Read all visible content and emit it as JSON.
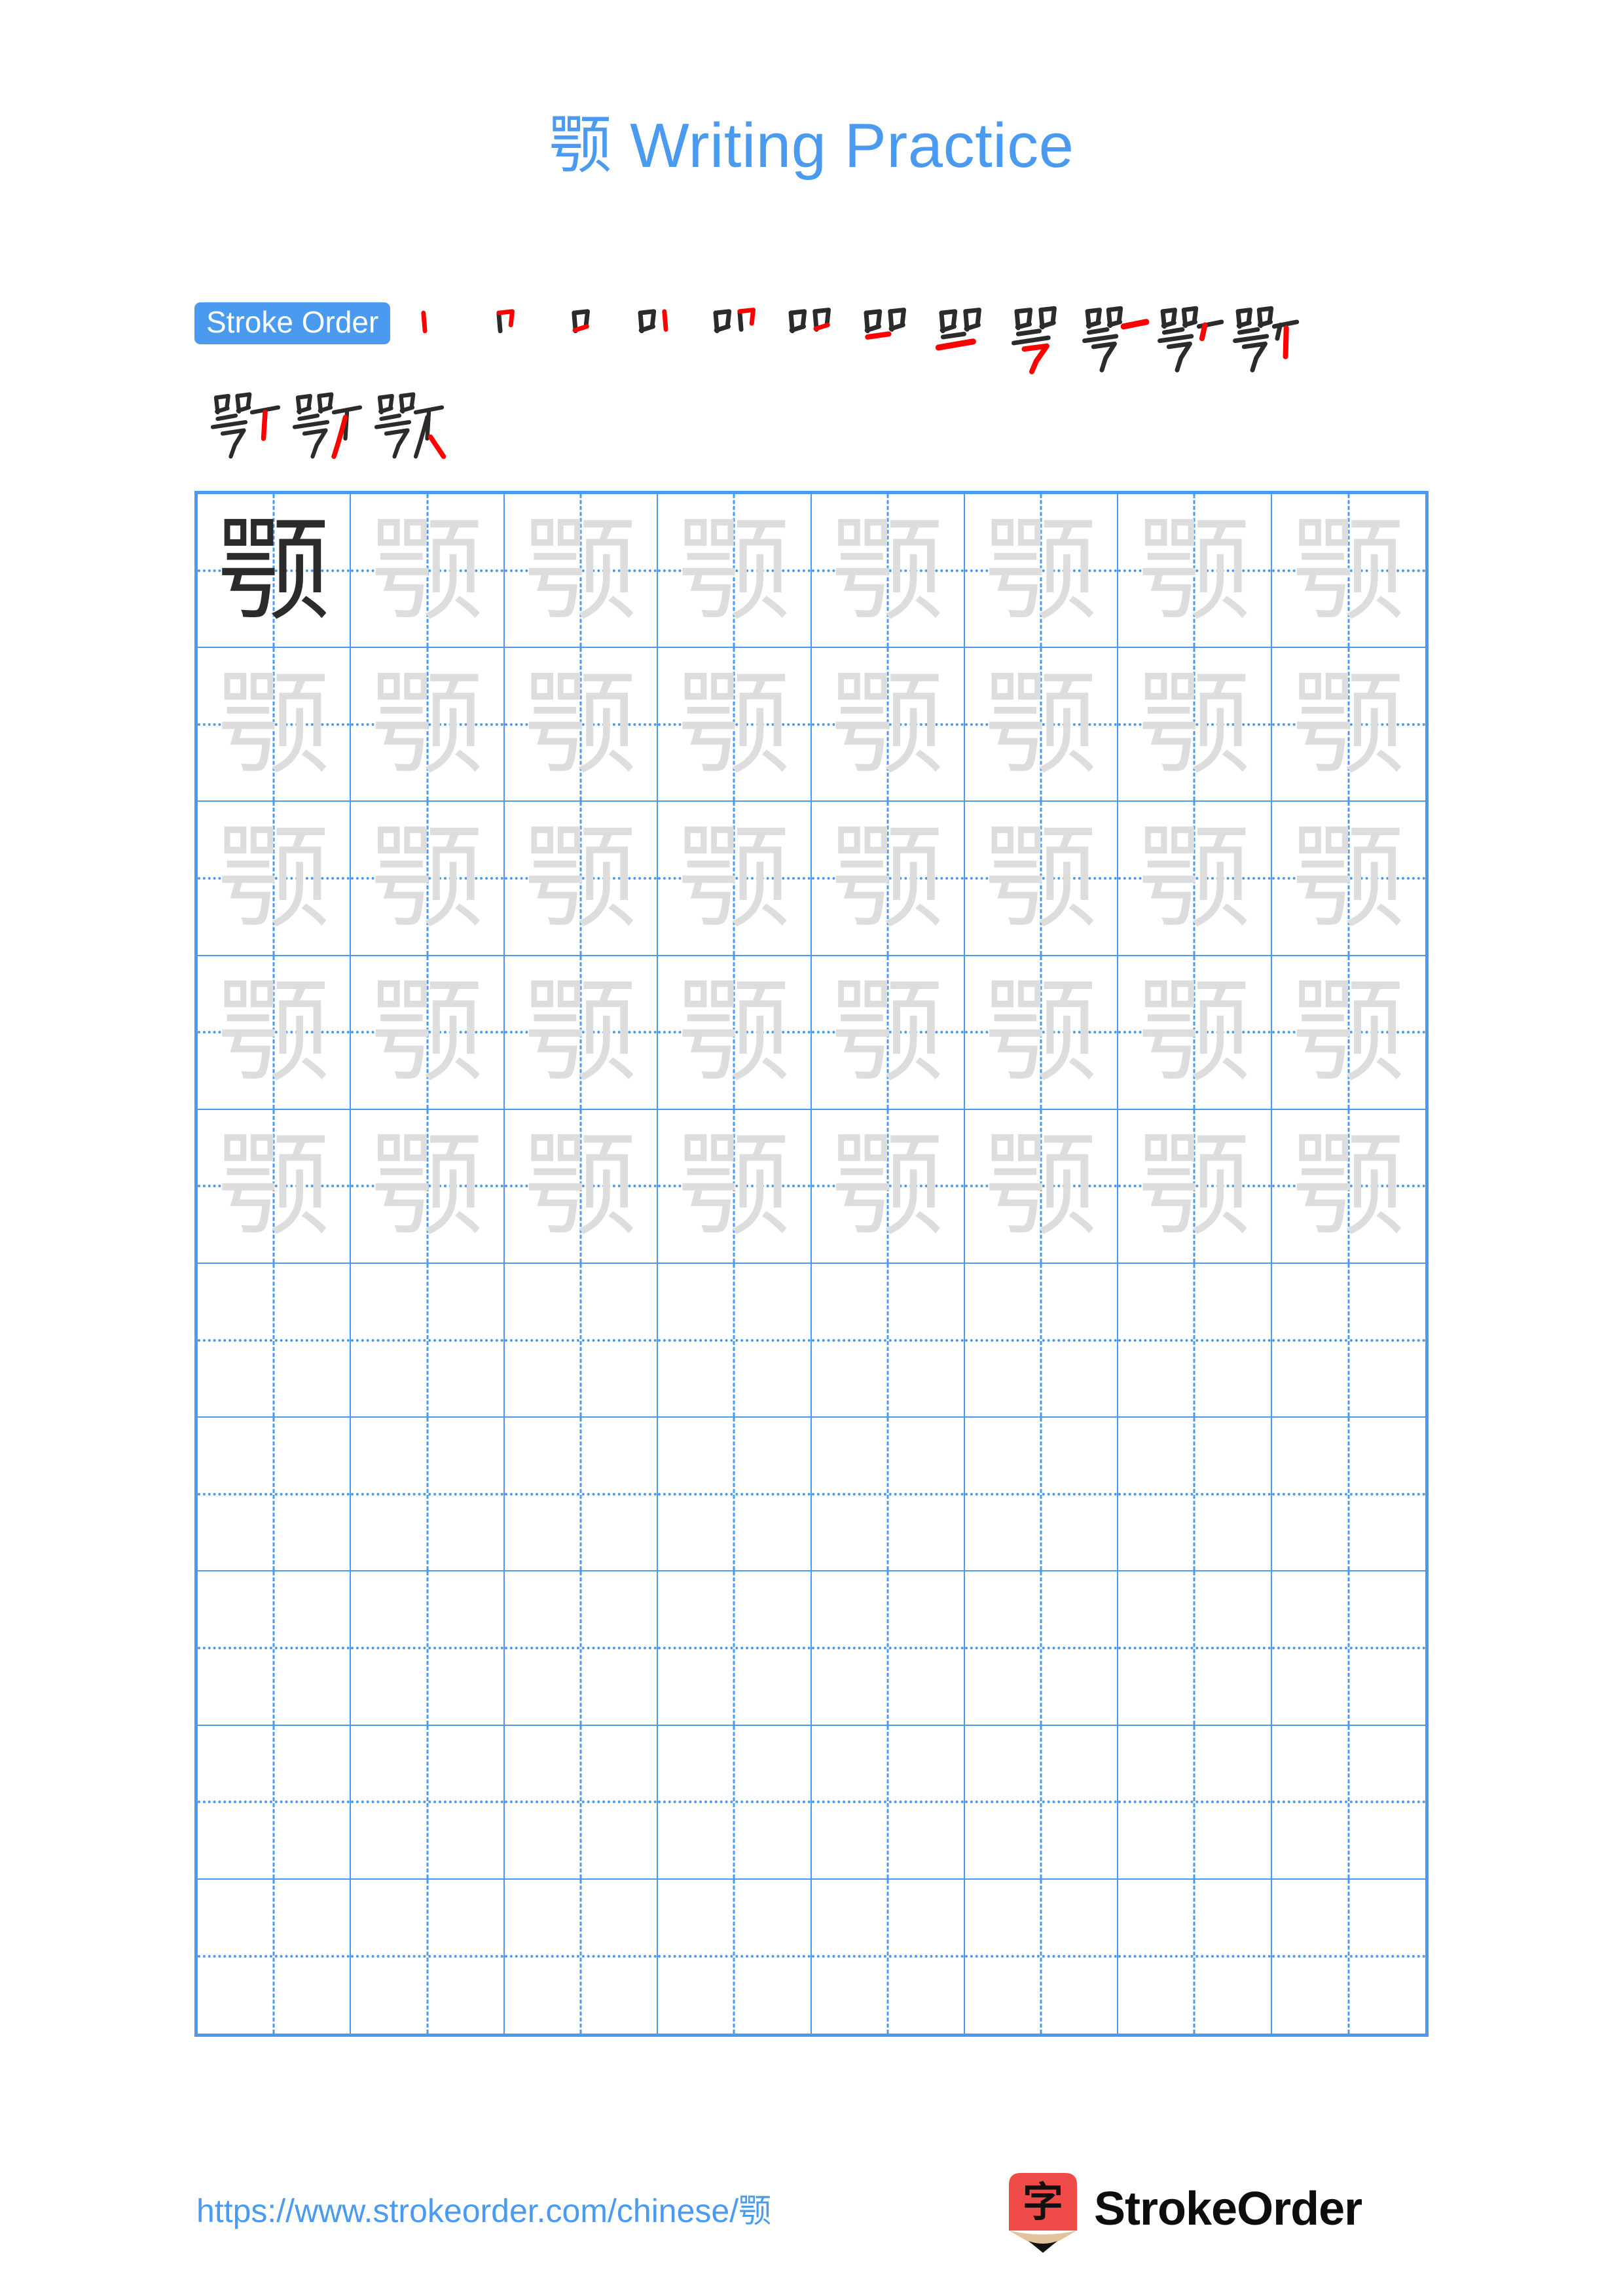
{
  "document": {
    "character": "颚",
    "title": "颚 Writing Practice",
    "accent_color": "#4a9bf0",
    "stroke_new_color": "#ff0000",
    "stroke_done_color": "#2b2b2b",
    "trace_color": "#dddddd",
    "solid_color": "#2b2b2b",
    "background": "#ffffff"
  },
  "stroke_order": {
    "badge_label": "Stroke Order",
    "total_strokes": 15,
    "steps": [
      {
        "index": 1,
        "label": "丨"
      },
      {
        "index": 2,
        "label": "冖"
      },
      {
        "index": 3,
        "label": "口"
      },
      {
        "index": 4,
        "label": "口丨"
      },
      {
        "index": 5,
        "label": "口冖"
      },
      {
        "index": 6,
        "label": "口口"
      },
      {
        "index": 7,
        "label": "吅一"
      },
      {
        "index": 8,
        "label": "吅二"
      },
      {
        "index": 9,
        "label": "咢"
      },
      {
        "index": 10,
        "label": "咢一"
      },
      {
        "index": 11,
        "label": "咢丆"
      },
      {
        "index": 12,
        "label": "咢丆丨"
      },
      {
        "index": 13,
        "label": "颚一"
      },
      {
        "index": 14,
        "label": "颚丿"
      },
      {
        "index": 15,
        "label": "颚"
      }
    ]
  },
  "practice_grid": {
    "columns": 8,
    "rows": 10,
    "filled_rows": 5,
    "solid_cell_index": 0,
    "trace_character": "颚",
    "solid_character": "颚"
  },
  "footer": {
    "url": "https://www.strokeorder.com/chinese/颚",
    "brand_name": "StrokeOrder",
    "logo_character": "字",
    "logo_body_color": "#ef4b49",
    "logo_wood_color": "#e3c39b",
    "logo_tip_color": "#111111"
  }
}
